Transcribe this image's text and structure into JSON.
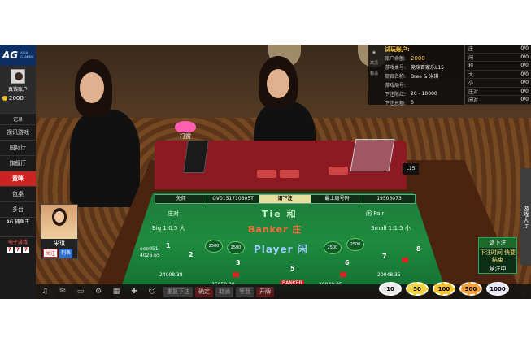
{
  "logo": {
    "text": "AG",
    "sub": "ASIA GAMING"
  },
  "account": {
    "label": "真钱账户",
    "balance": "2000"
  },
  "sidebar": {
    "items": [
      {
        "label": "记录",
        "small": true
      },
      {
        "label": "视讯游戏"
      },
      {
        "label": "国际厅"
      },
      {
        "label": "旗舰厅"
      },
      {
        "label": "竞咪",
        "active": true
      },
      {
        "label": "包桌"
      },
      {
        "label": "多台"
      }
    ],
    "ag_label": "AG 捕鱼王",
    "slots_label": "电子游戏",
    "slot_symbols": [
      "7",
      "7",
      "7"
    ]
  },
  "tip": {
    "label": "打赏"
  },
  "dealer": {
    "name": "米琪",
    "follow": "关注",
    "list": "列表"
  },
  "info_panel": {
    "title": "试玩账户:",
    "rows": [
      {
        "key": "账户余额:",
        "value": "2000",
        "gold": true
      },
      {
        "key": "游戏桌号:",
        "value": "竞咪百家乐L15"
      },
      {
        "key": "荷官名称:",
        "value": "Bree & 米琪"
      },
      {
        "key": "游戏局号:",
        "value": ""
      },
      {
        "key": "下注限红:",
        "value": "20 - 10000"
      },
      {
        "key": "下注总额:",
        "value": "0"
      }
    ],
    "left_icons": [
      "高清",
      "标清"
    ],
    "odds": [
      {
        "name": "庄",
        "value": "0/0"
      },
      {
        "name": "闲",
        "value": "0/0"
      },
      {
        "name": "和",
        "value": "0/0"
      },
      {
        "name": "大",
        "value": "0/0"
      },
      {
        "name": "小",
        "value": "0/0"
      },
      {
        "name": "庄对",
        "value": "0/0"
      },
      {
        "name": "闲对",
        "value": "0/0"
      }
    ]
  },
  "felt": {
    "bar": [
      "免佣",
      "GV0151710605T",
      "请下注",
      "最上局号码",
      "19503073"
    ],
    "tie": "Tie 和",
    "banker": "Banker 庄",
    "player": "Player 闲",
    "big": "Big 1:0.5 大",
    "small": "Small 1:1.5 小",
    "banker_pair": "庄对",
    "player_pair": "闲对",
    "player_pair2": "闲 Pair",
    "seats": [
      "2500",
      "2500",
      "2500",
      "2500"
    ],
    "numbers": [
      "1",
      "2",
      "3",
      "5",
      "6",
      "7",
      "8"
    ],
    "stats": [
      "4026.65",
      "24008.38",
      "25850.00",
      "20048.35",
      "20048.35"
    ],
    "player_label": "eee051",
    "banker_label": "BANKER",
    "l15": "L15"
  },
  "bet_panel": {
    "top": "请下注",
    "mid": "下注时间 快要结束",
    "bot": "竞注中"
  },
  "right_tab": "游戏大厅",
  "bottom": {
    "buttons": [
      "重复下注",
      "确定",
      "取消",
      "等我",
      "开牌"
    ],
    "icons": [
      "music-icon",
      "chat-icon",
      "screen-icon",
      "gear-icon",
      "table-icon",
      "add-user-icon",
      "user-icon",
      "coins-icon"
    ]
  },
  "chips": [
    {
      "label": "10",
      "color": "#e9e9e9"
    },
    {
      "label": "50",
      "color": "#f2d443"
    },
    {
      "label": "100",
      "color": "#f2c12e"
    },
    {
      "label": "500",
      "color": "#f4a03a"
    },
    {
      "label": "1000",
      "color": "#e8e8f8"
    }
  ]
}
